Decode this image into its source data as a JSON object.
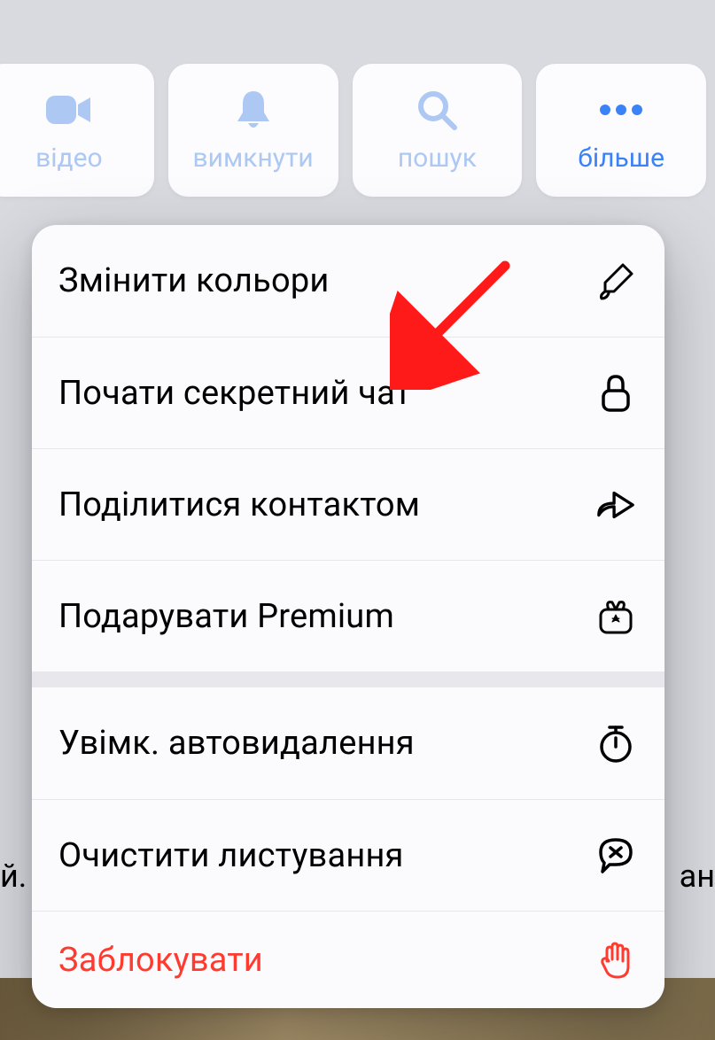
{
  "toolbar": {
    "video_label": "відео",
    "mute_label": "вимкнути",
    "search_label": "пошук",
    "more_label": "більше"
  },
  "menu": {
    "change_colors": "Змінити кольори",
    "secret_chat": "Почати секретний чат",
    "share_contact": "Поділитися контактом",
    "gift_premium": "Подарувати Premium",
    "auto_delete": "Увімк. автовидалення",
    "clear_history": "Очистити листування",
    "block": "Заблокувати"
  },
  "bg": {
    "left_fragment": "й.",
    "right_fragment": "ан"
  }
}
